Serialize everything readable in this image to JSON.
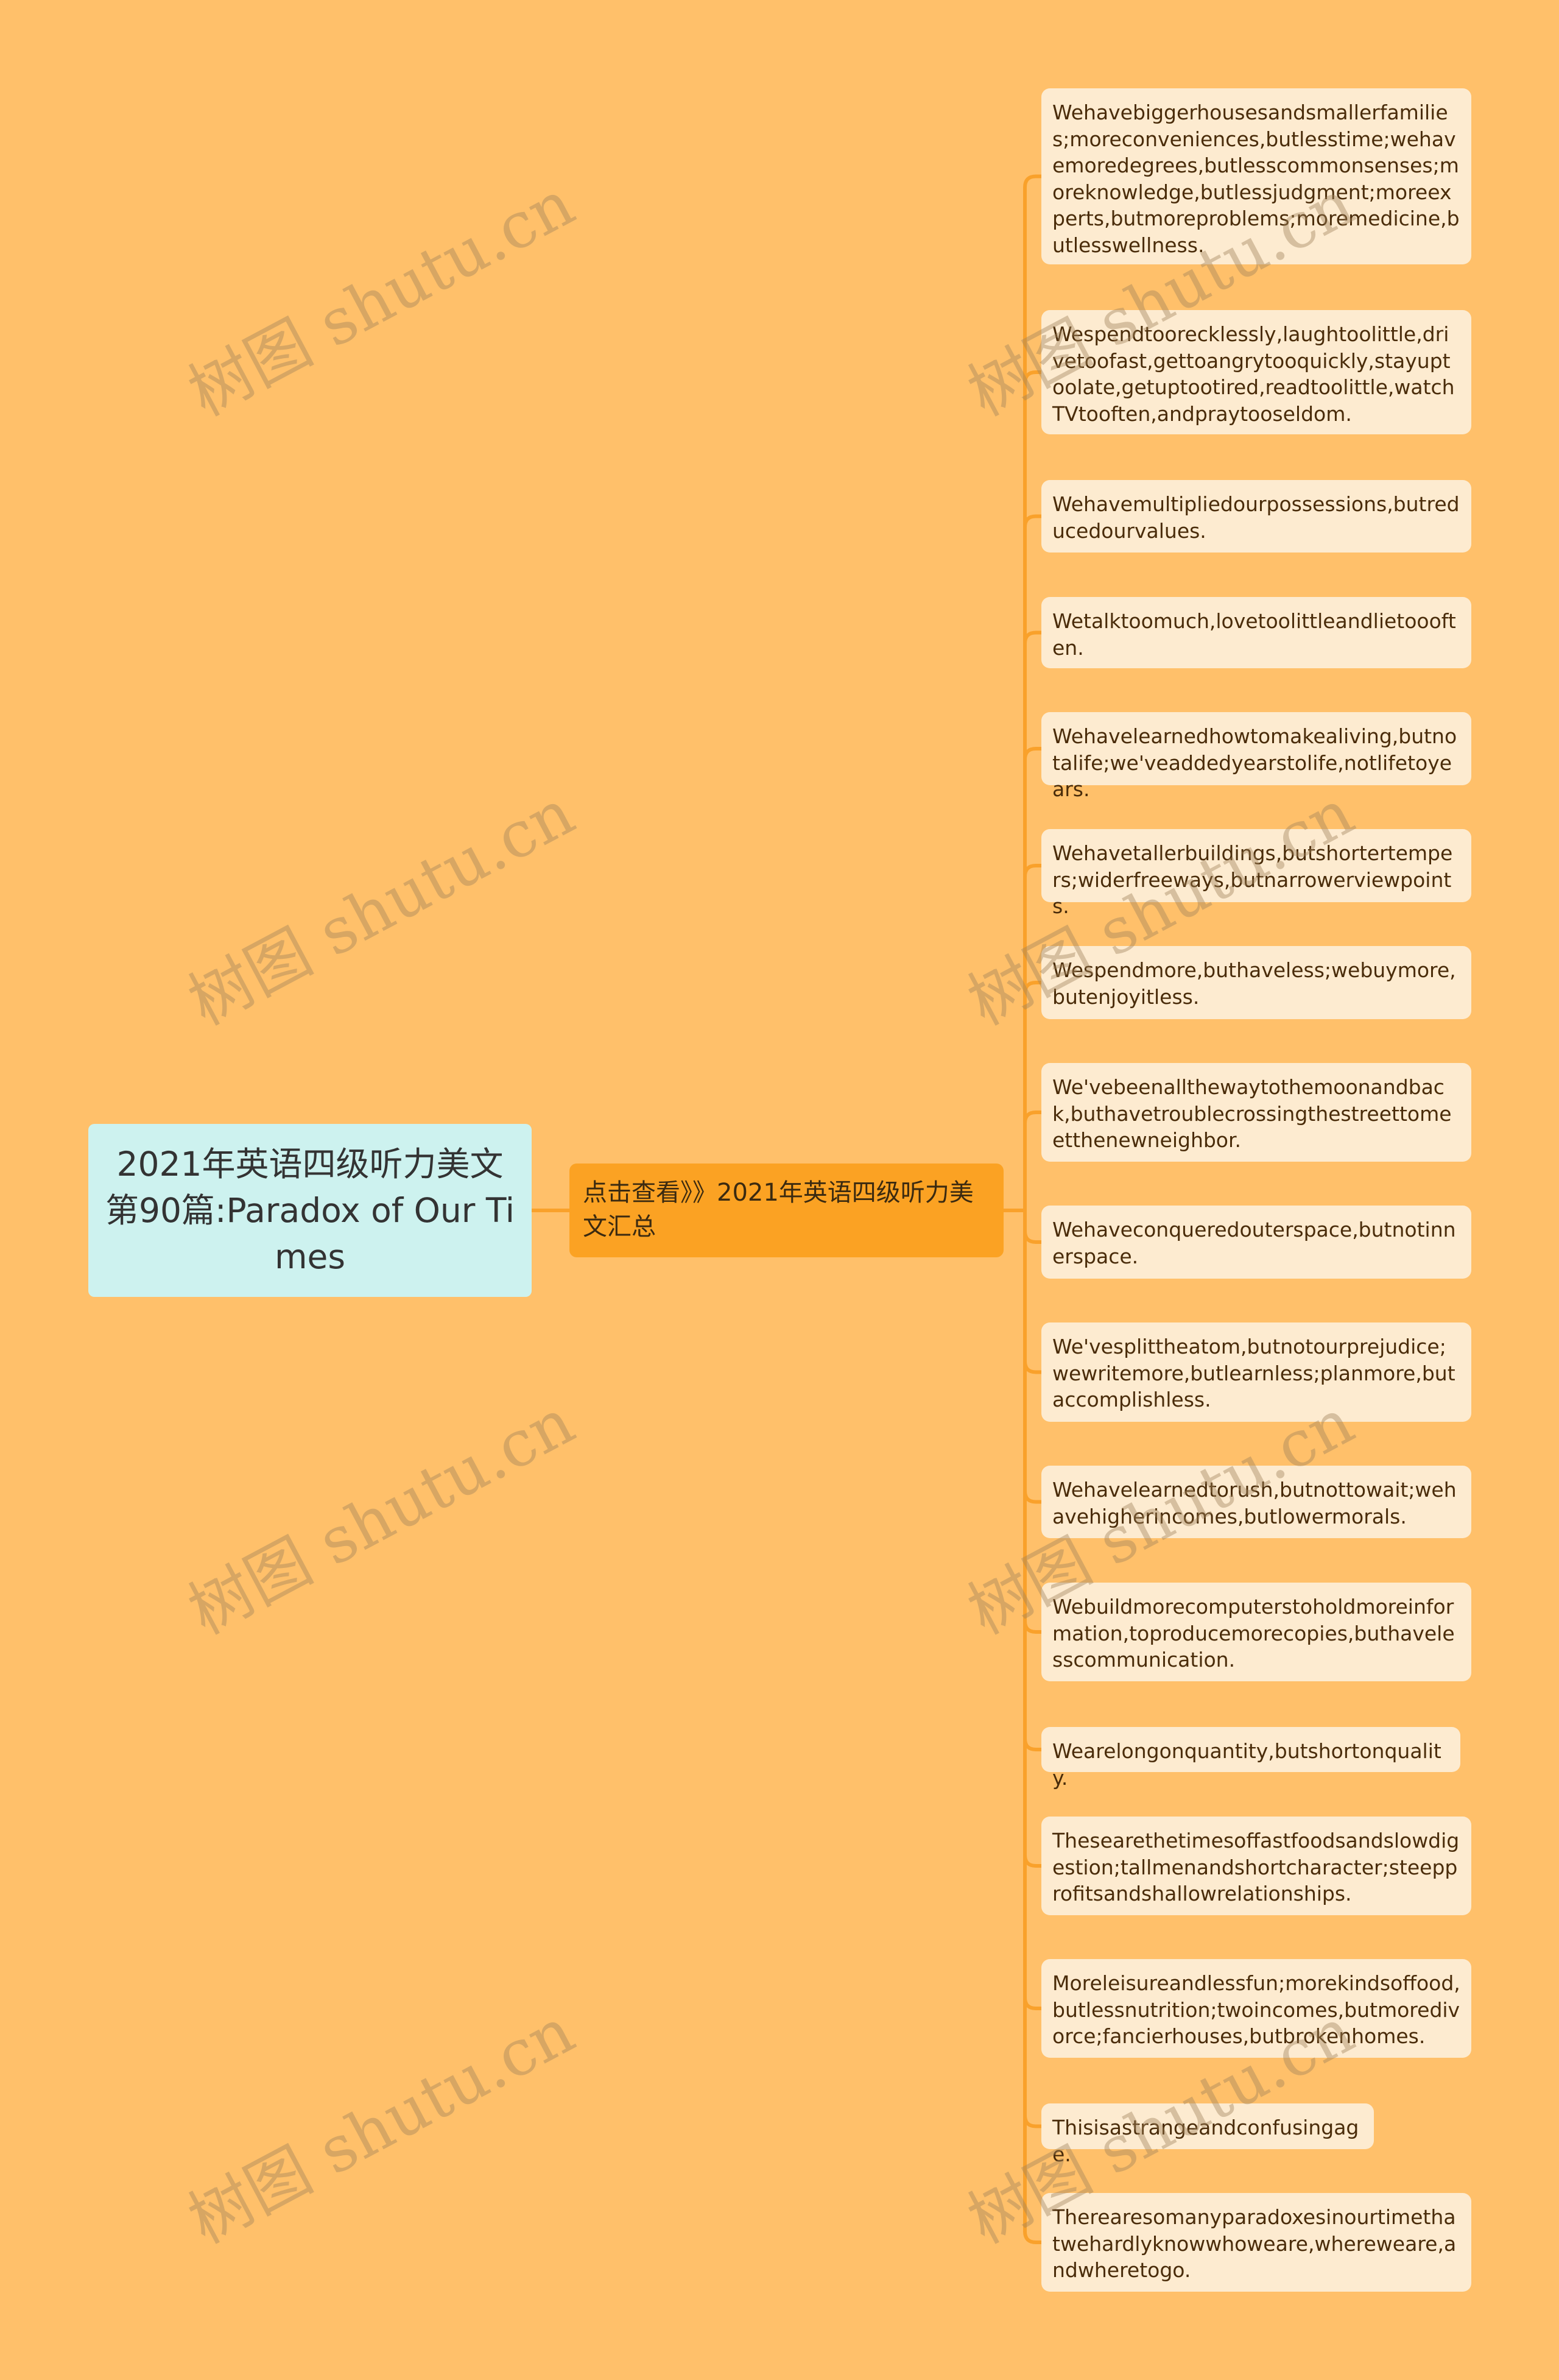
{
  "colors": {
    "background": "#ffc06a",
    "root_fill": "#cdf2ef",
    "middle_fill": "#fba223",
    "leaf_fill": "#fdebd0",
    "connector": "#f9a12b",
    "text_dark": "#4a2c0a"
  },
  "watermark_text": "树图 shutu.cn",
  "root": {
    "label": "2021年英语四级听力美文第90篇:Paradox of Our Times"
  },
  "middle": {
    "label": "点击查看》》2021年英语四级听力美文汇总"
  },
  "leaves": [
    {
      "label": "Wehavebiggerhousesandsmallerfamilies;moreconveniences,butlesstime;wehavemoredegrees,butlesscommonsenses;moreknowledge,butlessjudgment;moreexperts,butmoreproblems;moremedicine,butlesswellness."
    },
    {
      "label": "Wespendtoorecklessly,laughtoolittle,drivetoofast,gettoangrytooquickly,stayuptoolate,getuptootired,readtoolittle,watchTVtooften,andpraytooseldom."
    },
    {
      "label": "Wehavemultipliedourpossessions,butreducedourvalues."
    },
    {
      "label": "Wetalktoomuch,lovetoolittleandlietoooften."
    },
    {
      "label": "Wehavelearnedhowtomakealiving,butnotalife;we'veaddedyearstolife,notlifetoyears."
    },
    {
      "label": "Wehavetallerbuildings,butshortertempers;widerfreeways,butnarrowerviewpoints."
    },
    {
      "label": "Wespendmore,buthaveless;webuymore,butenjoyitless."
    },
    {
      "label": "We'vebeenallthewaytothemoonandback,buthavetroublecrossingthestreettomeetthenewneighbor."
    },
    {
      "label": "Wehaveconqueredouterspace,butnotinnerspace."
    },
    {
      "label": "We'vesplittheatom,butnotourprejudice;wewritemore,butlearnless;planmore,butaccomplishless."
    },
    {
      "label": "Wehavelearnedtorush,butnottowait;wehavehigherincomes,butlowermorals."
    },
    {
      "label": "Webuildmorecomputerstoholdmoreinformation,toproducemorecopies,buthavelesscommunication."
    },
    {
      "label": "Wearelongonquantity,butshortonquality."
    },
    {
      "label": "Thesearethetimesoffastfoodsandslowdigestion;tallmenandshortcharacter;steepprofitsandshallowrelationships."
    },
    {
      "label": "Moreleisureandlessfun;morekindsoffood,butlessnutrition;twoincomes,butmoredivorce;fancierhouses,butbrokenhomes."
    },
    {
      "label": "Thisisastrangeandconfusingage."
    },
    {
      "label": "Therearesomanyparadoxesinourtimethatwehardlyknowwhoweare,whereweare,andwheretogo."
    }
  ]
}
